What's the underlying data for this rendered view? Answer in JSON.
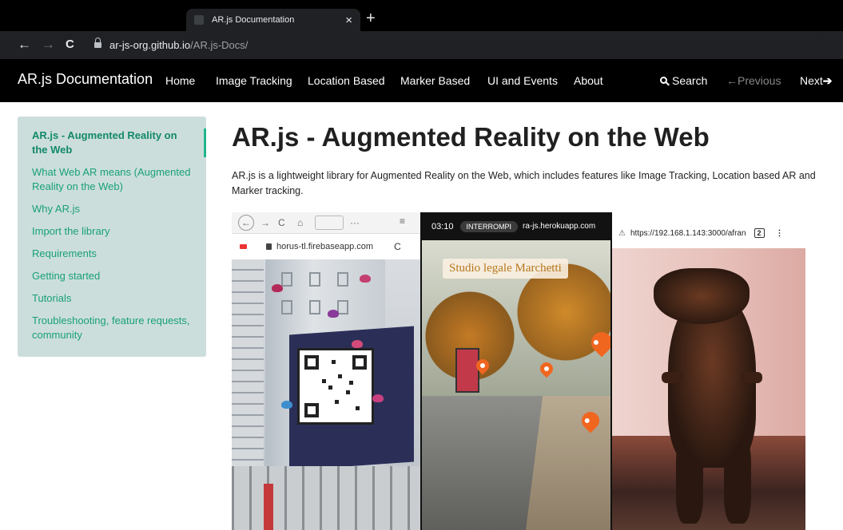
{
  "browser": {
    "tab_title": "AR.js Documentation",
    "tab_close_glyph": "×",
    "new_tab_glyph": "+",
    "back_glyph": "←",
    "forward_glyph": "→",
    "reload_glyph": "C",
    "url_host": "ar-js-org.github.io",
    "url_path": "/AR.js-Docs/"
  },
  "site_nav": {
    "brand": "AR.js Documentation",
    "links": [
      "Home",
      "Image Tracking",
      "Location Based",
      "Marker Based",
      "UI and Events",
      "About"
    ],
    "search_label": "Search",
    "previous_label": "Previous",
    "previous_glyph": "←",
    "next_label": "Next",
    "next_glyph": "➔"
  },
  "sidebar": {
    "items": [
      {
        "label": "AR.js - Augmented Reality on the Web",
        "active": true
      },
      {
        "label": "What Web AR means (Augmented Reality on the Web)",
        "active": false
      },
      {
        "label": "Why AR.js",
        "active": false
      },
      {
        "label": "Import the library",
        "active": false
      },
      {
        "label": "Requirements",
        "active": false
      },
      {
        "label": "Getting started",
        "active": false
      },
      {
        "label": "Tutorials",
        "active": false
      },
      {
        "label": "Troubleshooting, feature requests, community",
        "active": false
      }
    ]
  },
  "main": {
    "title": "AR.js - Augmented Reality on the Web",
    "intro": "AR.js is a lightweight library for Augmented Reality on the Web, which includes features like Image Tracking, Location based AR and Marker tracking."
  },
  "demo": {
    "panel1_url": "horus-tl.firebaseapp.com",
    "panel1_reload": "C",
    "panel2_status": "03:10",
    "panel2_pill": "INTERROMPI",
    "panel2_url": "ra-js.herokuapp.com",
    "panel2_sign": "Studio legale Marchetti",
    "panel3_url": "https://192.168.1.143:3000/afran",
    "panel3_tabs": "2",
    "panel3_menu": "⋮",
    "panel3_warning_icon": "warning-icon"
  },
  "colors": {
    "sidebar_bg": "#ccdedb",
    "link": "#18a07a",
    "nav_bg": "#000000"
  }
}
